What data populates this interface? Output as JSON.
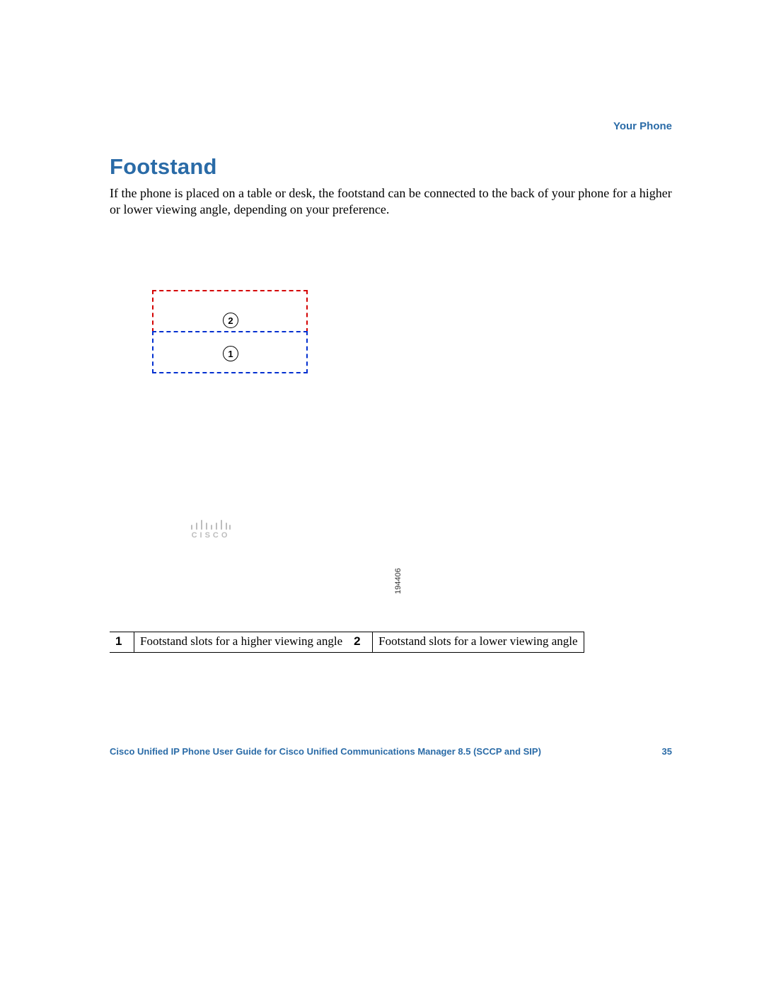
{
  "header": {
    "running_head": "Your Phone"
  },
  "section": {
    "heading": "Footstand",
    "body": "If the phone is placed on a table or desk, the footstand can be connected to the back of your phone for a higher or lower viewing angle, depending on your preference."
  },
  "figure": {
    "callouts": {
      "one": "1",
      "two": "2"
    },
    "image_id": "194406",
    "logo_text": "CISCO"
  },
  "callout_table": {
    "rows": [
      {
        "num": "1",
        "desc": "Footstand slots for a higher viewing angle"
      },
      {
        "num": "2",
        "desc": "Footstand slots for a lower viewing angle"
      }
    ]
  },
  "footer": {
    "title": "Cisco Unified IP Phone User Guide for Cisco Unified Communications Manager 8.5 (SCCP and SIP)",
    "page": "35"
  },
  "colors": {
    "accent": "#2a6ba7",
    "box_top": "#d40000",
    "box_bottom": "#0030d0",
    "logo_gray": "#bdbdbd"
  }
}
